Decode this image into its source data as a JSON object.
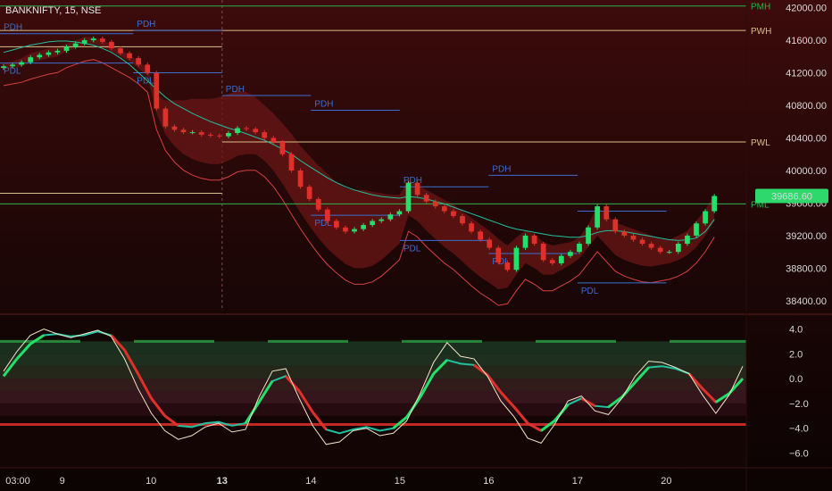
{
  "header": {
    "title": "BANKNIFTY, 15, NSE"
  },
  "colors": {
    "bg_top": "#3a0a0a",
    "bg_bottom": "#0a0303",
    "bull": "#22e06a",
    "bear": "#e0302a",
    "baseline": "#22c0a0",
    "band_fill": "#6a1515",
    "band_edge": "#d84040",
    "pdh": "#3a6fd0",
    "pwh": "#d8c08a",
    "pmh": "#2fb24a",
    "osc_fast": "#f0e6c8",
    "osc_slow": "#22c0a0",
    "price_tag": "#2fd86a"
  },
  "chart_data": [
    {
      "type": "line",
      "name": "price",
      "symbol": "BANKNIFTY",
      "interval": "15",
      "exchange": "NSE",
      "ylim": [
        38300,
        42050
      ],
      "yticks": [
        42000,
        41600,
        41200,
        40800,
        40400,
        40000,
        39600,
        39200,
        38800,
        38400
      ],
      "ytick_labels": [
        "42000.00",
        "41600.00",
        "41200.00",
        "40800.00",
        "40400.00",
        "40000.00",
        "39600.00",
        "39200.00",
        "38800.00",
        "38400.00"
      ],
      "last_price": "39686.60",
      "x_labels": [
        {
          "pos": 0,
          "text": "03:00"
        },
        {
          "pos": 7,
          "text": "9"
        },
        {
          "pos": 17,
          "text": "10"
        },
        {
          "pos": 25,
          "text": "13",
          "bold": true
        },
        {
          "pos": 35,
          "text": "14"
        },
        {
          "pos": 45,
          "text": "15"
        },
        {
          "pos": 55,
          "text": "16"
        },
        {
          "pos": 65,
          "text": "17"
        },
        {
          "pos": 75,
          "text": "20"
        }
      ],
      "x_range": [
        0,
        84
      ],
      "close": [
        41280,
        41300,
        41330,
        41390,
        41420,
        41450,
        41470,
        41520,
        41560,
        41600,
        41620,
        41580,
        41500,
        41440,
        41380,
        41300,
        41200,
        40760,
        40540,
        40500,
        40470,
        40470,
        40440,
        40430,
        40420,
        40460,
        40520,
        40510,
        40470,
        40400,
        40350,
        40200,
        40000,
        39800,
        39650,
        39520,
        39380,
        39300,
        39250,
        39280,
        39330,
        39380,
        39400,
        39460,
        39500,
        39850,
        39700,
        39620,
        39560,
        39500,
        39440,
        39350,
        39250,
        39150,
        39050,
        38870,
        38780,
        39050,
        39200,
        39100,
        38900,
        38860,
        38950,
        39000,
        39100,
        39300,
        39560,
        39400,
        39250,
        39200,
        39150,
        39100,
        39050,
        39000,
        39000,
        39100,
        39200,
        39350,
        39500,
        39686.6
      ],
      "baseline": [
        41450,
        41480,
        41510,
        41540,
        41560,
        41580,
        41590,
        41590,
        41580,
        41560,
        41540,
        41500,
        41450,
        41380,
        41300,
        41200,
        41100,
        41000,
        40900,
        40820,
        40760,
        40700,
        40650,
        40600,
        40560,
        40520,
        40490,
        40450,
        40410,
        40370,
        40320,
        40260,
        40200,
        40120,
        40050,
        39980,
        39910,
        39850,
        39800,
        39760,
        39730,
        39700,
        39680,
        39670,
        39660,
        39680,
        39670,
        39650,
        39620,
        39590,
        39550,
        39510,
        39470,
        39430,
        39390,
        39350,
        39310,
        39280,
        39260,
        39240,
        39220,
        39200,
        39190,
        39180,
        39180,
        39200,
        39240,
        39260,
        39260,
        39250,
        39230,
        39210,
        39190,
        39170,
        39150,
        39140,
        39150,
        39170,
        39250,
        39400
      ],
      "band_upper": [
        41320,
        41340,
        41380,
        41440,
        41470,
        41500,
        41520,
        41560,
        41600,
        41640,
        41640,
        41600,
        41540,
        41480,
        41420,
        41340,
        41260,
        40900,
        40860,
        40860,
        40860,
        40880,
        40880,
        40880,
        40900,
        40940,
        40980,
        40960,
        40900,
        40800,
        40700,
        40580,
        40450,
        40300,
        40180,
        40060,
        39960,
        39850,
        39780,
        39760,
        39760,
        39740,
        39720,
        39700,
        39700,
        39880,
        39820,
        39760,
        39700,
        39640,
        39580,
        39500,
        39420,
        39340,
        39260,
        39160,
        39080,
        39180,
        39260,
        39220,
        39120,
        39080,
        39100,
        39120,
        39180,
        39340,
        39560,
        39460,
        39360,
        39320,
        39280,
        39240,
        39200,
        39160,
        39150,
        39200,
        39260,
        39380,
        39520,
        39700
      ],
      "band_lower": [
        41240,
        41260,
        41280,
        41320,
        41350,
        41380,
        41400,
        41460,
        41500,
        41540,
        41560,
        41520,
        41460,
        41400,
        41340,
        41260,
        41160,
        40700,
        40440,
        40300,
        40200,
        40140,
        40100,
        40080,
        40080,
        40120,
        40180,
        40200,
        40200,
        40120,
        40000,
        39840,
        39660,
        39480,
        39320,
        39170,
        39040,
        38940,
        38850,
        38800,
        38800,
        38830,
        38900,
        39000,
        39100,
        39450,
        39380,
        39260,
        39160,
        39060,
        38980,
        38880,
        38780,
        38690,
        38620,
        38540,
        38560,
        38720,
        38860,
        38800,
        38720,
        38720,
        38780,
        38840,
        38920,
        39060,
        39200,
        39080,
        38960,
        38900,
        38860,
        38830,
        38820,
        38840,
        38860,
        38900,
        38960,
        39060,
        39200,
        39380
      ],
      "levels": [
        {
          "label": "PMH",
          "price": 42020,
          "x0": 0,
          "x1": 84,
          "color": "#2fb24a",
          "label_pos": "right"
        },
        {
          "label": "PWH",
          "price": 41720,
          "x0": 0,
          "x1": 84,
          "color": "#d8c08a",
          "label_pos": "right"
        },
        {
          "label": "PWL",
          "price": 40350,
          "x0": 25,
          "x1": 84,
          "color": "#d8c08a",
          "label_pos": "right"
        },
        {
          "label": "PML",
          "price": 39590,
          "x0": 0,
          "x1": 84,
          "color": "#2fb24a",
          "label_pos": "right"
        },
        {
          "label": "",
          "price": 41520,
          "x0": 0,
          "x1": 25,
          "color": "#d8c08a",
          "label_pos": "none"
        },
        {
          "label": "",
          "price": 39720,
          "x0": 0,
          "x1": 25,
          "color": "#d8c08a",
          "label_pos": "none"
        },
        {
          "label": "PDH",
          "price": 41680,
          "x0": 0,
          "x1": 15,
          "color": "#3a6fd0",
          "label_pos": "above-start"
        },
        {
          "label": "PDH",
          "price": 41720,
          "x0": 15,
          "x1": 25,
          "color": "#3a6fd0",
          "label_pos": "above-start"
        },
        {
          "label": "PDH",
          "price": 40920,
          "x0": 25,
          "x1": 35,
          "color": "#3a6fd0",
          "label_pos": "above-start"
        },
        {
          "label": "PDH",
          "price": 40740,
          "x0": 35,
          "x1": 45,
          "color": "#3a6fd0",
          "label_pos": "above-start"
        },
        {
          "label": "PDH",
          "price": 39800,
          "x0": 45,
          "x1": 55,
          "color": "#3a6fd0",
          "label_pos": "above-start"
        },
        {
          "label": "PDH",
          "price": 39940,
          "x0": 55,
          "x1": 65,
          "color": "#3a6fd0",
          "label_pos": "above-start"
        },
        {
          "label": "PDL",
          "price": 41320,
          "x0": 0,
          "x1": 15,
          "color": "#3a6fd0",
          "label_pos": "below-start"
        },
        {
          "label": "PDL",
          "price": 41200,
          "x0": 15,
          "x1": 25,
          "color": "#3a6fd0",
          "label_pos": "below-start"
        },
        {
          "label": "PDL",
          "price": 39450,
          "x0": 35,
          "x1": 45,
          "color": "#3a6fd0",
          "label_pos": "below-start"
        },
        {
          "label": "PDL",
          "price": 39140,
          "x0": 45,
          "x1": 55,
          "color": "#3a6fd0",
          "label_pos": "below-start"
        },
        {
          "label": "PDL",
          "price": 38980,
          "x0": 55,
          "x1": 65,
          "color": "#3a6fd0",
          "label_pos": "below-start"
        },
        {
          "label": "PDL",
          "price": 38620,
          "x0": 65,
          "x1": 75,
          "color": "#3a6fd0",
          "label_pos": "below-start"
        },
        {
          "label": "",
          "price": 39500,
          "x0": 65,
          "x1": 75,
          "color": "#3a6fd0",
          "label_pos": "none"
        }
      ]
    },
    {
      "type": "line",
      "name": "oscillator",
      "ylim": [
        -6.9,
        4.9
      ],
      "yticks": [
        4,
        2,
        0,
        -2,
        -4,
        -6
      ],
      "ytick_labels": [
        "4.0",
        "2.0",
        "0.0",
        "−2.0",
        "−4.0",
        "−6.0"
      ],
      "fast": [
        0.6,
        2.2,
        3.5,
        4.0,
        3.6,
        3.3,
        3.6,
        3.9,
        3.4,
        1.6,
        -0.8,
        -2.8,
        -4.2,
        -4.9,
        -4.6,
        -3.9,
        -3.6,
        -4.3,
        -4.1,
        -1.5,
        0.6,
        0.8,
        -1.6,
        -3.8,
        -5.3,
        -5.1,
        -4.2,
        -4.0,
        -4.6,
        -4.4,
        -3.4,
        -1.2,
        1.3,
        2.9,
        1.8,
        1.6,
        0.2,
        -1.8,
        -3.1,
        -4.8,
        -5.2,
        -3.7,
        -1.8,
        -1.4,
        -2.6,
        -2.9,
        -1.6,
        0.2,
        1.4,
        1.3,
        0.9,
        0.4,
        -1.3,
        -2.8,
        -1.3,
        1.0
      ],
      "slow": [
        0.2,
        1.6,
        2.8,
        3.5,
        3.6,
        3.4,
        3.5,
        3.8,
        3.5,
        2.3,
        0.4,
        -1.6,
        -3.0,
        -3.8,
        -3.9,
        -3.6,
        -3.5,
        -3.8,
        -3.6,
        -1.9,
        -0.2,
        0.2,
        -1.0,
        -2.7,
        -4.1,
        -4.4,
        -4.1,
        -3.9,
        -4.2,
        -4.0,
        -3.1,
        -1.5,
        0.4,
        1.5,
        1.2,
        1.1,
        0.3,
        -1.1,
        -2.3,
        -3.6,
        -4.2,
        -3.4,
        -2.1,
        -1.6,
        -2.2,
        -2.3,
        -1.5,
        -0.3,
        0.9,
        1.0,
        0.8,
        0.4,
        -0.8,
        -1.9,
        -1.2,
        0.0
      ]
    }
  ]
}
